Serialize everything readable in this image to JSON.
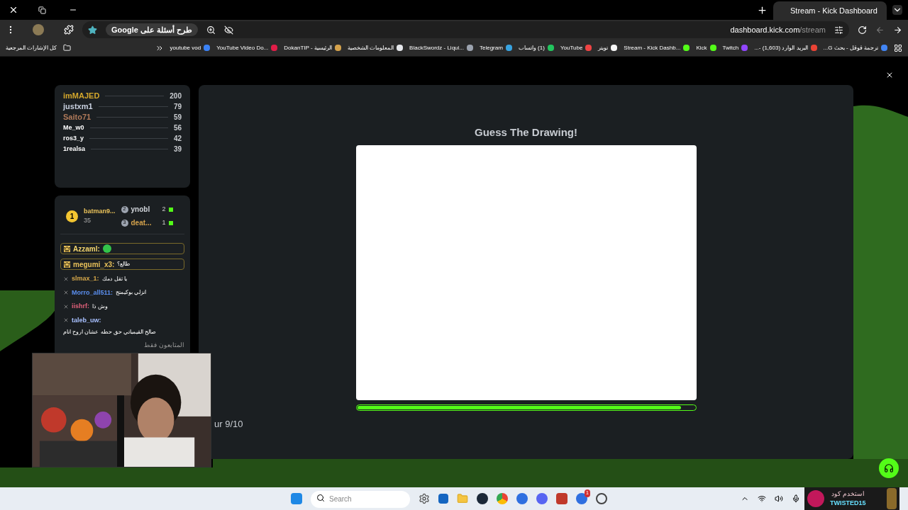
{
  "browser": {
    "tabs": [
      {
        "title": "Stream - Kick Dashboard",
        "selected": true
      }
    ],
    "address_chip": "طرح أسئلة على Google",
    "url": {
      "host": "dashboard.kick.com",
      "path": "/stream"
    },
    "bookmarks": [
      {
        "title": "ترجمة قوقل - بحث G...",
        "color": "#4285f4"
      },
      {
        "title": "البريد الوارد (1,603) -...",
        "color": "#ea4335"
      },
      {
        "title": "Twitch",
        "color": "#9146ff"
      },
      {
        "title": "Kick",
        "color": "#53fc18"
      },
      {
        "title": "Stream - Kick Dashb...",
        "color": "#53fc18"
      },
      {
        "title": "تويتر",
        "color": "#f5f5f5"
      },
      {
        "title": "YouTube",
        "color": "#ef4444"
      },
      {
        "title": "(1) واتساب",
        "color": "#22c55e"
      },
      {
        "title": "Telegram",
        "color": "#38a3e0"
      },
      {
        "title": "BlackSwordz - Liqui...",
        "color": "#9ca3af"
      },
      {
        "title": "المعلومات الشخصية",
        "color": "#e5e7eb"
      },
      {
        "title": "DokanTIP - الرئيسية",
        "color": "#d4a24c"
      },
      {
        "title": "YouTube Video Do...",
        "color": "#e11d48"
      },
      {
        "title": "youtube vod",
        "color": "#3b82f6"
      }
    ],
    "all_bookmarks": "كل الإشارات المرجعية"
  },
  "leaderboard": [
    {
      "name": "imMAJED",
      "score": "200",
      "color": "#d4a72c"
    },
    {
      "name": "justxm1",
      "score": "79",
      "color": "#c9d1e0"
    },
    {
      "name": "Saito71",
      "score": "59",
      "color": "#b07a5a"
    },
    {
      "name": "Me_w0",
      "score": "56",
      "color": "#ffffff"
    },
    {
      "name": "ros3_y",
      "score": "42",
      "color": "#ffffff"
    },
    {
      "name": "1realsa",
      "score": "39",
      "color": "#ffffff"
    }
  ],
  "chat": {
    "top": {
      "rank": "1",
      "name": "batman9...",
      "score": "35"
    },
    "runners": [
      {
        "rank": "2",
        "name": "ynobl",
        "score": "2",
        "color": "#d1d5db"
      },
      {
        "rank": "3",
        "name": "deat...",
        "score": "1",
        "color": "#d4a24c"
      }
    ],
    "messages": [
      {
        "kind": "highlight",
        "name": "Azzaml:",
        "color": "#f5d76e"
      },
      {
        "kind": "highlight",
        "name": "megumi_x3:",
        "text": "طالع؟",
        "color": "#e8c15a"
      },
      {
        "kind": "plain",
        "name": "slmax_1:",
        "text": "يا ثقل دمك",
        "color": "#d6a84a"
      },
      {
        "kind": "plain",
        "name": "Morro_all511:",
        "text": "انزلي بوكيمتج",
        "color": "#5b8ff0"
      },
      {
        "kind": "plain",
        "name": "iishrf:",
        "text": "وش ذا",
        "color": "#e0607a"
      },
      {
        "kind": "plain",
        "name": "taleb_uw:",
        "text": "صالح القيمباتي حق حطه عشان اروح انام",
        "color": "#a8c0ff"
      }
    ],
    "mode": "المتابعون فقط"
  },
  "game": {
    "title": "Guess The Drawing!",
    "progress": {
      "level": 0.96
    },
    "round": "ur 9/10"
  },
  "taskbar": {
    "search": {
      "placeholder": "Search"
    },
    "badge": "1"
  },
  "promo": {
    "line_1": "استخدم كود",
    "line_2": "TWISTED15"
  }
}
